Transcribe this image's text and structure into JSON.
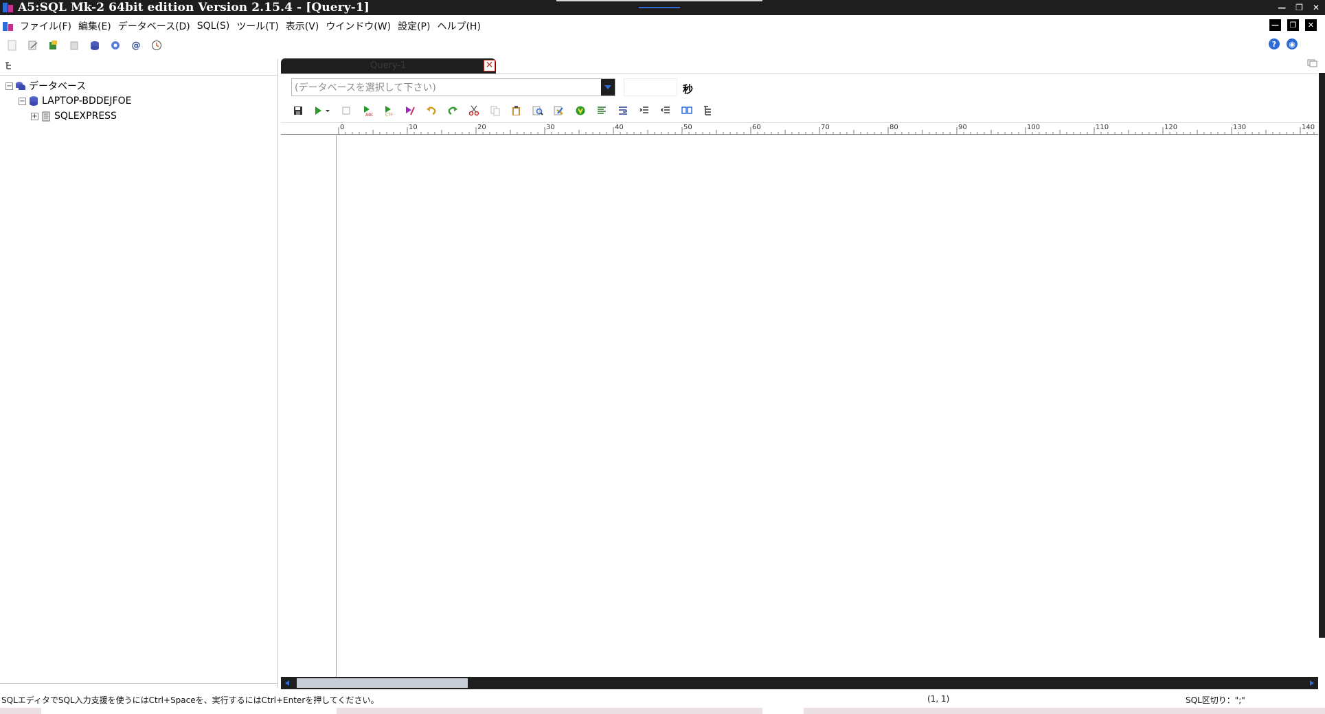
{
  "window": {
    "title": "A5:SQL Mk-2 64bit edition Version 2.15.4 - [Query-1]",
    "controls": [
      "—",
      "❐",
      "✕"
    ]
  },
  "menu": {
    "items": [
      "ファイル(F)",
      "編集(E)",
      "データベース(D)",
      "SQL(S)",
      "ツール(T)",
      "表示(V)",
      "ウインドウ(W)",
      "設定(P)",
      "ヘルプ(H)"
    ]
  },
  "mdi_controls": [
    "—",
    "❐",
    "✕"
  ],
  "tree": {
    "root": "データベース",
    "server": "LAPTOP-BDDEJFOE",
    "instance": "SQLEXPRESS"
  },
  "tab": {
    "label": "Query-1",
    "close": "✕"
  },
  "db_select": {
    "placeholder": "(データベースを選択して下さい)"
  },
  "timeout": {
    "unit_label": "秒"
  },
  "ruler": {
    "labels": [
      "0",
      "10",
      "20",
      "30",
      "40",
      "50",
      "60",
      "70",
      "80",
      "90",
      "100",
      "110",
      "120",
      "130",
      "140"
    ]
  },
  "status": {
    "message": "SQLエディタでSQL入力支援を使うにはCtrl+Spaceを、実行するにはCtrl+Enterを押してください。",
    "position": "(1, 1)",
    "separator": "SQL区切り：\";\""
  },
  "colors": {
    "accent": "#2d6bd6",
    "dark": "#1e1e1e"
  },
  "scroll": {
    "horizontal_fraction": 0.17
  }
}
